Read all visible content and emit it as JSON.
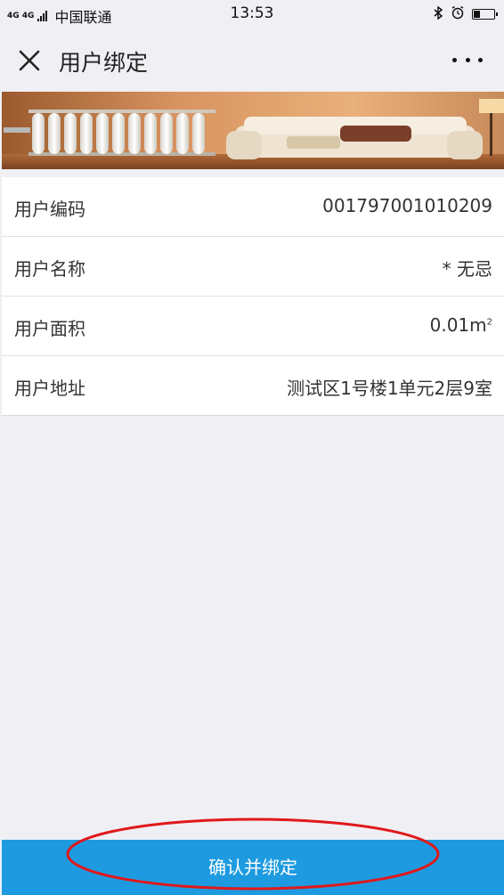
{
  "status_bar": {
    "network": "4G 4G",
    "carrier": "中国联通",
    "time": "13:53",
    "battery_level": 0.35
  },
  "nav": {
    "title": "用户绑定",
    "close_icon": "close-icon",
    "more_icon": "more-dots-icon"
  },
  "banner": {
    "image": "room-radiator-banner"
  },
  "info": {
    "rows": [
      {
        "label": "用户编码",
        "value": "001797001010209"
      },
      {
        "label": "用户名称",
        "value": "* 无忌"
      },
      {
        "label": "用户面积",
        "value": "0.01",
        "unit": "m",
        "unit_sup": "2"
      },
      {
        "label": "用户地址",
        "value": "测试区1号楼1单元2层9室"
      }
    ]
  },
  "confirm": {
    "label": "确认并绑定"
  },
  "colors": {
    "background": "#efeff4",
    "button": "#1e9be0",
    "annotation": "#e0181b"
  }
}
